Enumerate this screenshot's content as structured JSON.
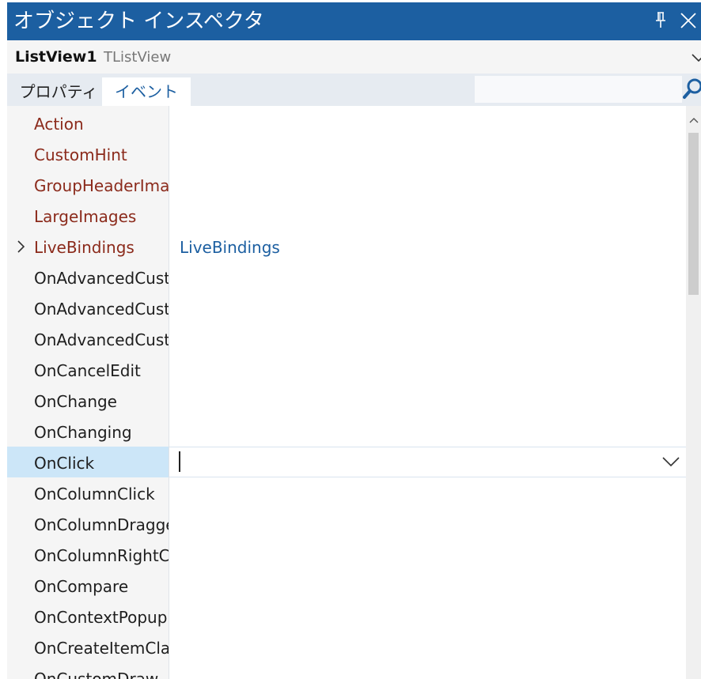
{
  "window": {
    "title": "オブジェクト インスペクタ",
    "colors": {
      "titlebar": "#1c5fa1",
      "reference_event": "#8b2a1b",
      "value_link": "#1c5fa1",
      "selection": "#cce6f8"
    }
  },
  "component": {
    "name": "ListView1",
    "type": "TListView"
  },
  "tabs": {
    "properties": "プロパティ",
    "events": "イベント",
    "active": "イベント"
  },
  "search": {
    "value": "",
    "placeholder": ""
  },
  "rows": [
    {
      "name": "Action",
      "value": ""
    },
    {
      "name": "CustomHint",
      "value": ""
    },
    {
      "name": "GroupHeaderImages",
      "value": ""
    },
    {
      "name": "LargeImages",
      "value": ""
    },
    {
      "name": "LiveBindings",
      "value": "LiveBindings"
    },
    {
      "name": "OnAdvancedCustomDraw",
      "value": ""
    },
    {
      "name": "OnAdvancedCustomDrawItem",
      "value": ""
    },
    {
      "name": "OnAdvancedCustomDrawSubItem",
      "value": ""
    },
    {
      "name": "OnCancelEdit",
      "value": ""
    },
    {
      "name": "OnChange",
      "value": ""
    },
    {
      "name": "OnChanging",
      "value": ""
    },
    {
      "name": "OnClick",
      "value": ""
    },
    {
      "name": "OnColumnClick",
      "value": ""
    },
    {
      "name": "OnColumnDragged",
      "value": ""
    },
    {
      "name": "OnColumnRightClick",
      "value": ""
    },
    {
      "name": "OnCompare",
      "value": ""
    },
    {
      "name": "OnContextPopup",
      "value": ""
    },
    {
      "name": "OnCreateItemClass",
      "value": ""
    },
    {
      "name": "OnCustomDraw",
      "value": ""
    }
  ],
  "selected_row": "OnClick",
  "icons": [
    "pin-icon",
    "close-icon",
    "chevron-down-icon",
    "search-icon",
    "chevron-right-icon",
    "scroll-up-arrow-icon"
  ]
}
